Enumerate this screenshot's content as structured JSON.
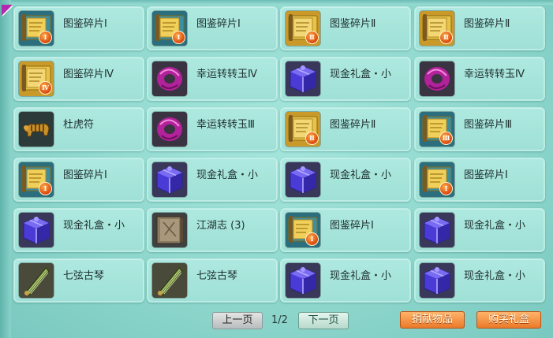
{
  "items": [
    {
      "name": "图鉴碎片Ⅰ",
      "icon": "scroll-fragment-icon",
      "roman": "Ⅰ",
      "kind": "scroll-teal"
    },
    {
      "name": "图鉴碎片Ⅰ",
      "icon": "scroll-fragment-icon",
      "roman": "Ⅰ",
      "kind": "scroll-teal"
    },
    {
      "name": "图鉴碎片Ⅱ",
      "icon": "scroll-fragment-icon",
      "roman": "Ⅱ",
      "kind": "scroll-gold"
    },
    {
      "name": "图鉴碎片Ⅱ",
      "icon": "scroll-fragment-icon",
      "roman": "Ⅱ",
      "kind": "scroll-gold"
    },
    {
      "name": "图鉴碎片Ⅳ",
      "icon": "scroll-fragment-icon",
      "roman": "Ⅳ",
      "kind": "scroll-gold"
    },
    {
      "name": "幸运转转玉Ⅳ",
      "icon": "lucky-jade-icon",
      "roman": "",
      "kind": "jade"
    },
    {
      "name": "现金礼盒・小",
      "icon": "gift-box-icon",
      "roman": "",
      "kind": "box"
    },
    {
      "name": "幸运转转玉Ⅳ",
      "icon": "lucky-jade-icon",
      "roman": "",
      "kind": "jade"
    },
    {
      "name": "杜虎符",
      "icon": "tiger-tally-icon",
      "roman": "",
      "kind": "tiger"
    },
    {
      "name": "幸运转转玉Ⅲ",
      "icon": "lucky-jade-icon",
      "roman": "",
      "kind": "jade"
    },
    {
      "name": "图鉴碎片Ⅱ",
      "icon": "scroll-fragment-icon",
      "roman": "Ⅱ",
      "kind": "scroll-gold"
    },
    {
      "name": "图鉴碎片Ⅲ",
      "icon": "scroll-fragment-icon",
      "roman": "Ⅲ",
      "kind": "scroll-teal"
    },
    {
      "name": "图鉴碎片Ⅰ",
      "icon": "scroll-fragment-icon",
      "roman": "Ⅰ",
      "kind": "scroll-teal"
    },
    {
      "name": "现金礼盒・小",
      "icon": "gift-box-icon",
      "roman": "",
      "kind": "box"
    },
    {
      "name": "现金礼盒・小",
      "icon": "gift-box-icon",
      "roman": "",
      "kind": "box"
    },
    {
      "name": "图鉴碎片Ⅰ",
      "icon": "scroll-fragment-icon",
      "roman": "Ⅰ",
      "kind": "scroll-teal"
    },
    {
      "name": "现金礼盒・小",
      "icon": "gift-box-icon",
      "roman": "",
      "kind": "box"
    },
    {
      "name": "江湖志 (3)",
      "icon": "jianghu-book-icon",
      "roman": "",
      "kind": "book"
    },
    {
      "name": "图鉴碎片Ⅰ",
      "icon": "scroll-fragment-icon",
      "roman": "Ⅰ",
      "kind": "scroll-teal"
    },
    {
      "name": "现金礼盒・小",
      "icon": "gift-box-icon",
      "roman": "",
      "kind": "box"
    },
    {
      "name": "七弦古琴",
      "icon": "guqin-icon",
      "roman": "",
      "kind": "qin"
    },
    {
      "name": "七弦古琴",
      "icon": "guqin-icon",
      "roman": "",
      "kind": "qin"
    },
    {
      "name": "现金礼盒・小",
      "icon": "gift-box-icon",
      "roman": "",
      "kind": "box"
    },
    {
      "name": "现金礼盒・小",
      "icon": "gift-box-icon",
      "roman": "",
      "kind": "box"
    }
  ],
  "pager": {
    "prev_label": "上一页",
    "page_text": "1/2",
    "next_label": "下一页"
  },
  "actions": {
    "donate_label": "捐献物品",
    "buy_gift_label": "购买礼盒"
  },
  "colors": {
    "panel": "#8fd9d0",
    "cell": "#a6e6dc",
    "orange_button": "#ea7a2a",
    "badge": "#d9460f"
  }
}
